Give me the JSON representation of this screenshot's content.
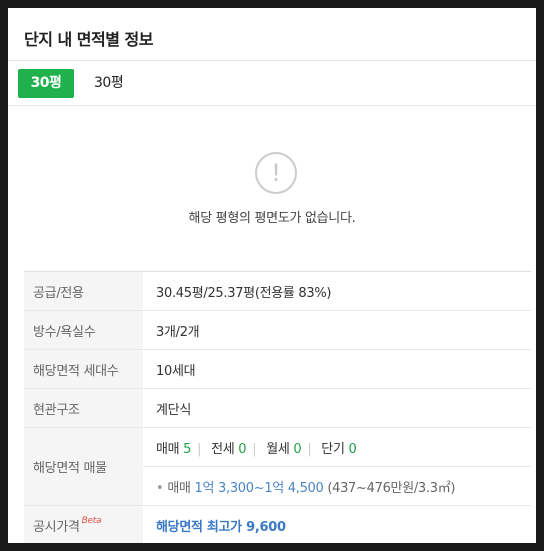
{
  "section_title": "단지 내 면적별 정보",
  "tabs": [
    {
      "label": "30평"
    },
    {
      "label": "30평"
    }
  ],
  "notice": {
    "icon": "exclamation-circle-icon",
    "text": "해당 평형의 평면도가 없습니다."
  },
  "rows": {
    "area": {
      "label": "공급/전용",
      "value": "30.45평/25.37평(전용률 83%)"
    },
    "rooms": {
      "label": "방수/욕실수",
      "value": "3개/2개"
    },
    "households": {
      "label": "해당면적 세대수",
      "value": "10세대"
    },
    "entrance": {
      "label": "현관구조",
      "value": "계단식"
    },
    "listings": {
      "label": "해당면적 매물",
      "counts": [
        {
          "type": "매매",
          "count": "5"
        },
        {
          "type": "전세",
          "count": "0"
        },
        {
          "type": "월세",
          "count": "0"
        },
        {
          "type": "단기",
          "count": "0"
        }
      ],
      "price_type": "매매",
      "price_range": "1억 3,300~1억 4,500",
      "price_detail": "(437~476만원/3.3㎡)"
    },
    "official_price": {
      "label": "공시가격",
      "beta": "Beta",
      "value": "해당면적 최고가 9,600"
    }
  }
}
